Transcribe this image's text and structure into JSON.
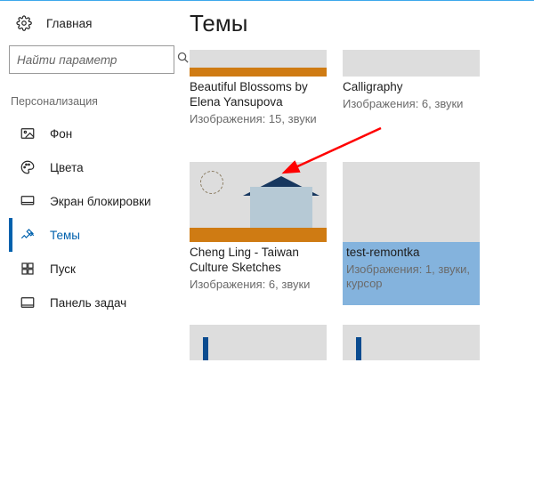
{
  "sidebar": {
    "home_label": "Главная",
    "search_placeholder": "Найти параметр",
    "section_caption": "Персонализация",
    "items": [
      {
        "label": "Фон"
      },
      {
        "label": "Цвета"
      },
      {
        "label": "Экран блокировки"
      },
      {
        "label": "Темы"
      },
      {
        "label": "Пуск"
      },
      {
        "label": "Панель задач"
      }
    ]
  },
  "page_title": "Темы",
  "themes": [
    {
      "name": "Beautiful Blossoms by Elena Yansupova",
      "meta": "Изображения: 15, звуки"
    },
    {
      "name": "Calligraphy",
      "meta": "Изображения: 6, звуки"
    },
    {
      "name": "Cheng Ling - Taiwan Culture Sketches",
      "meta": "Изображения: 6, звуки"
    },
    {
      "name": "test-remontka",
      "meta": "Изображения: 1, звуки, курсор"
    }
  ]
}
